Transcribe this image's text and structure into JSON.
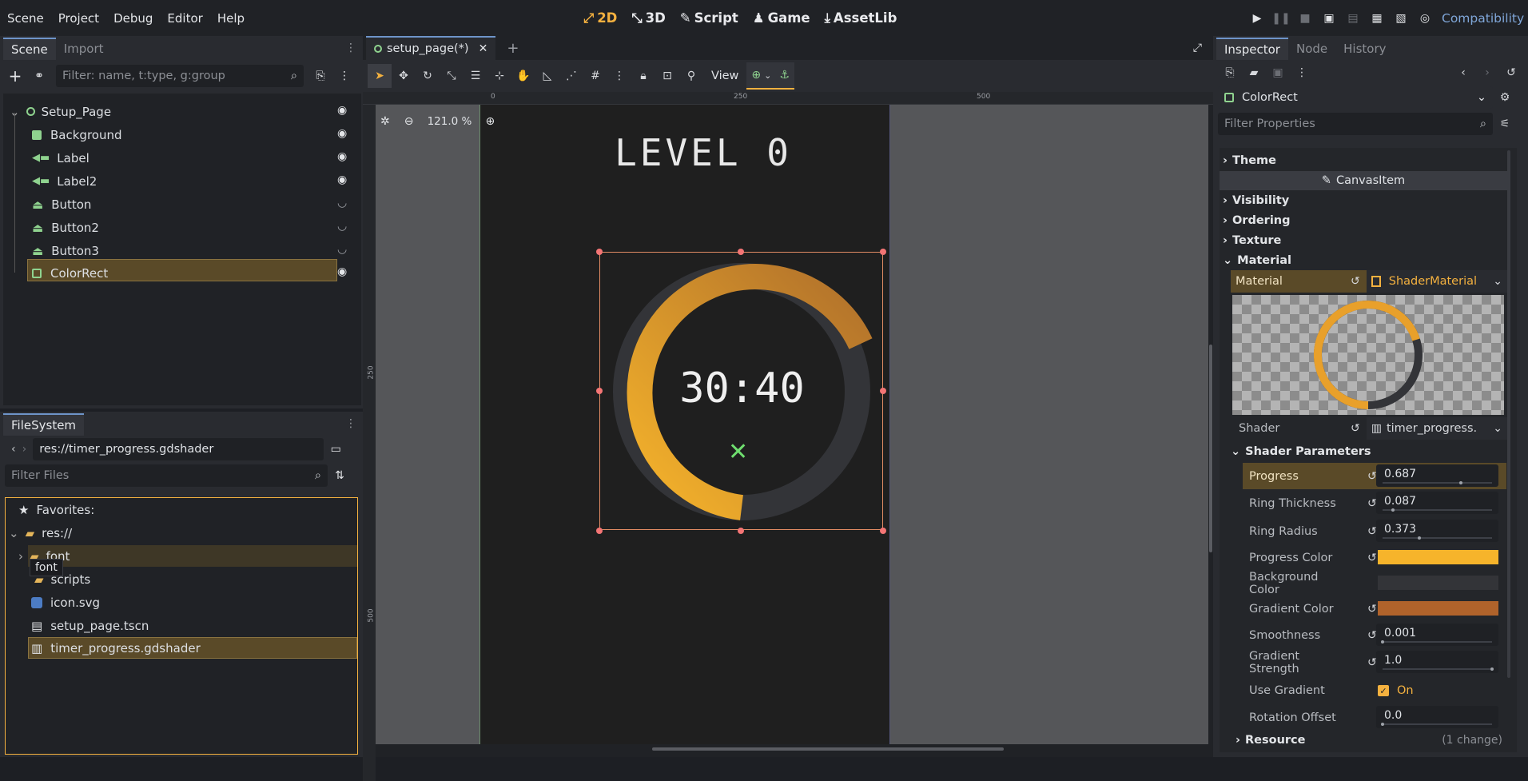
{
  "menu": [
    "Scene",
    "Project",
    "Debug",
    "Editor",
    "Help"
  ],
  "workspaces": [
    {
      "label": "2D",
      "active": true
    },
    {
      "label": "3D"
    },
    {
      "label": "Script"
    },
    {
      "label": "Game"
    },
    {
      "label": "AssetLib"
    }
  ],
  "renderer": "Compatibility",
  "scene_dock": {
    "tabs": [
      "Scene",
      "Import"
    ],
    "filter_placeholder": "Filter: name, t:type, g:group",
    "nodes": [
      {
        "name": "Setup_Page"
      },
      {
        "name": "Background"
      },
      {
        "name": "Label"
      },
      {
        "name": "Label2"
      },
      {
        "name": "Button"
      },
      {
        "name": "Button2"
      },
      {
        "name": "Button3"
      },
      {
        "name": "ColorRect",
        "selected": true
      }
    ]
  },
  "filesystem": {
    "tab": "FileSystem",
    "path": "res://timer_progress.gdshader",
    "filter_placeholder": "Filter Files",
    "favorites": "Favorites:",
    "root": "res://",
    "items": [
      "font",
      "scripts",
      "icon.svg",
      "setup_page.tscn",
      "timer_progress.gdshader"
    ],
    "tooltip": "font"
  },
  "editor": {
    "tab": "setup_page(*)",
    "view_label": "View",
    "zoom": "121.0 %",
    "ruler_top": [
      "0",
      "250",
      "500"
    ],
    "ruler_left": [
      "250",
      "500"
    ],
    "title": "LEVEL 0",
    "timer": "30:40"
  },
  "inspector": {
    "tabs": [
      "Inspector",
      "Node",
      "History"
    ],
    "node": "ColorRect",
    "filter_placeholder": "Filter Properties",
    "theme": "Theme",
    "canvas_item": "CanvasItem",
    "sections": [
      "Visibility",
      "Ordering",
      "Texture",
      "Material"
    ],
    "material_label": "Material",
    "material_value": "ShaderMaterial",
    "shader_label": "Shader",
    "shader_value": "timer_progress.",
    "shader_params": "Shader Parameters",
    "progress": {
      "label": "Progress",
      "value": "0.687"
    },
    "ring_thickness": {
      "label": "Ring Thickness",
      "value": "0.087"
    },
    "ring_radius": {
      "label": "Ring Radius",
      "value": "0.373"
    },
    "progress_color": {
      "label": "Progress Color",
      "color": "#f6b42b"
    },
    "background_color": {
      "label": "Background Color",
      "color": "#333438"
    },
    "gradient_color": {
      "label": "Gradient Color",
      "color": "#b0632b"
    },
    "smoothness": {
      "label": "Smoothness",
      "value": "0.001"
    },
    "gradient_strength": {
      "label": "Gradient Strength",
      "value": "1.0"
    },
    "use_gradient": {
      "label": "Use Gradient",
      "value": "On"
    },
    "rotation_offset": {
      "label": "Rotation Offset",
      "value": "0.0"
    },
    "resource": "Resource",
    "changes": "(1 change)"
  },
  "colors": {
    "accent": "#f4b13f",
    "selection": "#5a4a28",
    "blue": "#6e94c9"
  }
}
